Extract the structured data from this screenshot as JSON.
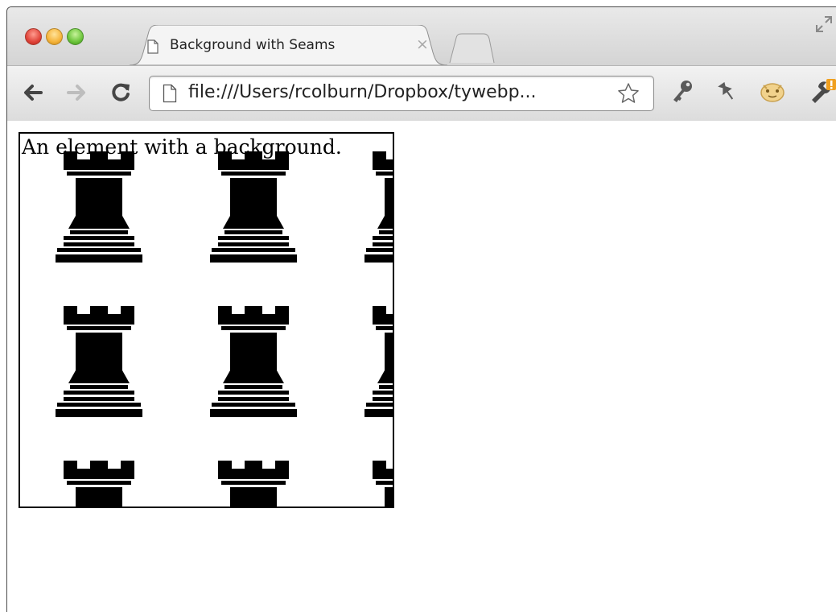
{
  "browser": {
    "tab_title": "Background with Seams",
    "tab_close_glyph": "×",
    "url": "file:///Users/rcolburn/Dropbox/tywebp...",
    "icons": [
      "back-icon",
      "forward-icon",
      "reload-icon",
      "page-icon",
      "bookmark-star-icon",
      "wrench-key-icon",
      "pin-icon",
      "extension-icon",
      "settings-wrench-icon"
    ]
  },
  "page": {
    "element_text": "An element with a background."
  },
  "colors": {
    "tile_icon": "#000000",
    "box_border": "#000000"
  }
}
